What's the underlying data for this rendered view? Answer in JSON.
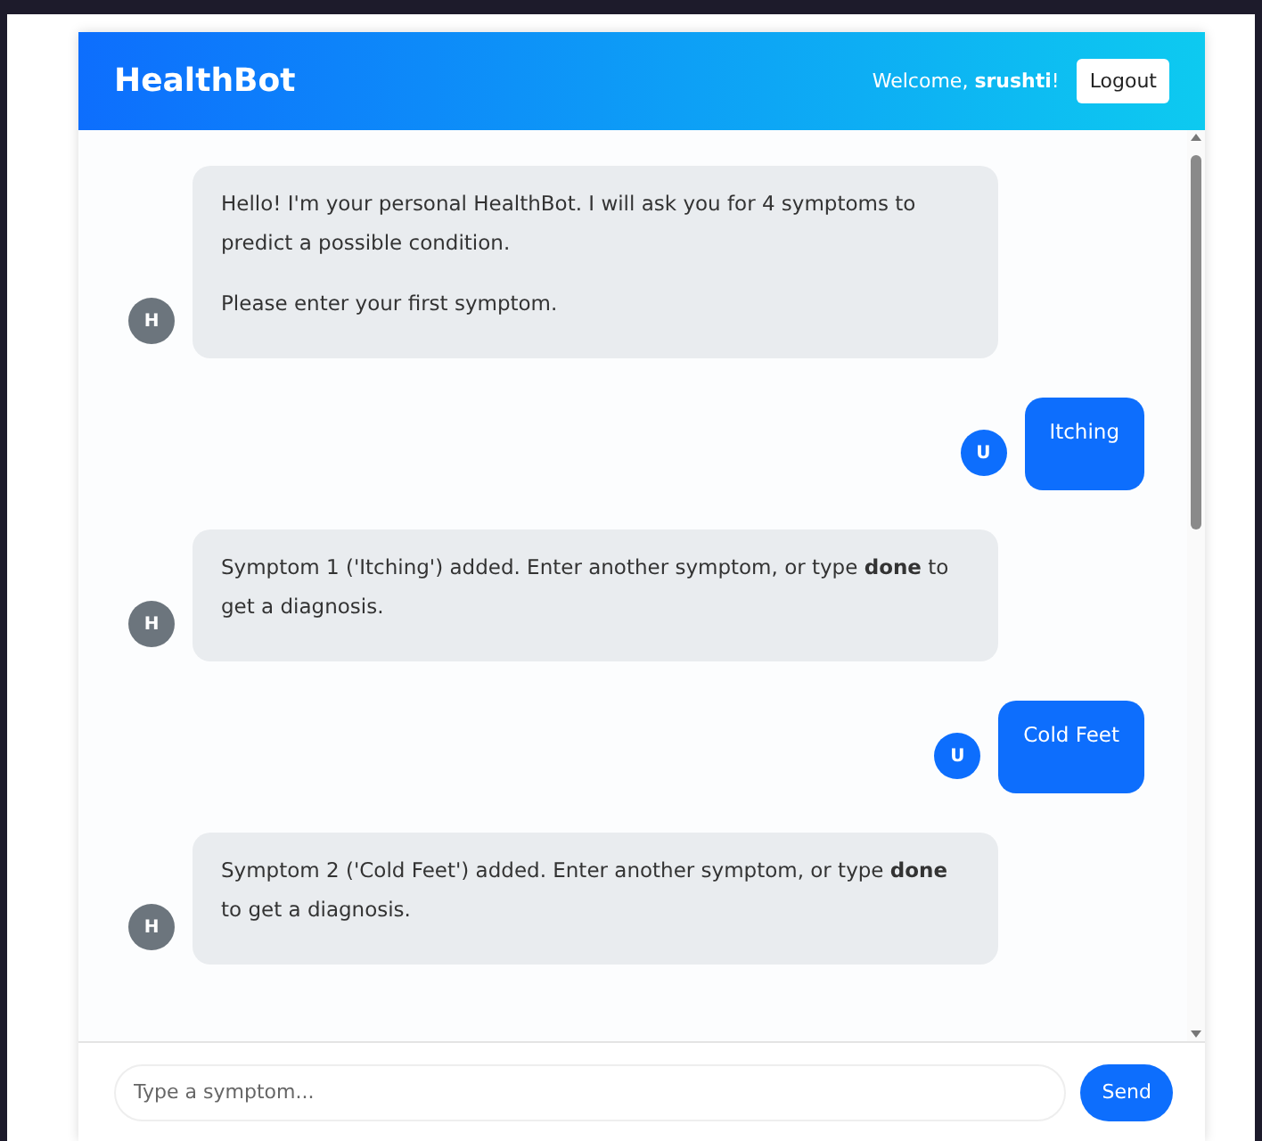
{
  "header": {
    "title": "HealthBot",
    "welcome": "Welcome, **srushti**!",
    "logout": "Logout"
  },
  "messages": [
    {
      "kind": "bot",
      "avatar": "H",
      "paragraphs": [
        "Hello! I'm your personal HealthBot. I will ask you for 4 symptoms to predict a possible condition.",
        "Please enter your first symptom."
      ]
    },
    {
      "kind": "user",
      "avatar": "U",
      "paragraphs": [
        "Itching"
      ]
    },
    {
      "kind": "bot",
      "avatar": "H",
      "paragraphs": [
        "Symptom 1 ('Itching') added. Enter another symptom, or type **done** to get a diagnosis."
      ]
    },
    {
      "kind": "user",
      "avatar": "U",
      "paragraphs": [
        "Cold Feet"
      ]
    },
    {
      "kind": "bot",
      "avatar": "H",
      "paragraphs": [
        "Symptom 2 ('Cold Feet') added. Enter another symptom, or type **done** to get a diagnosis."
      ]
    }
  ],
  "composer": {
    "placeholder": "Type a symptom...",
    "send": "Send"
  }
}
